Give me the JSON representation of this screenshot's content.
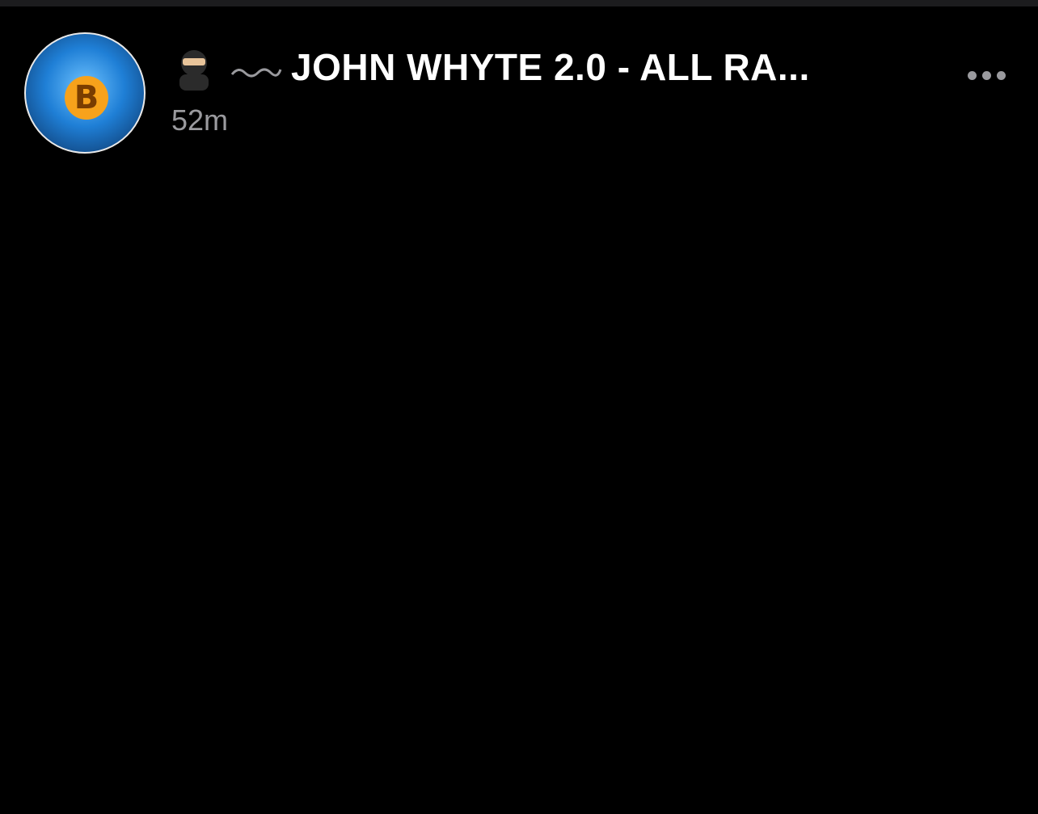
{
  "post": {
    "author": "JOHN WHYTE 2.0 - ALL RA...",
    "timestamp": "52m",
    "avatar_icon": "avatar-image",
    "badge_icon": "ninja-emoji-icon",
    "menu_icon": "more-options-icon"
  }
}
